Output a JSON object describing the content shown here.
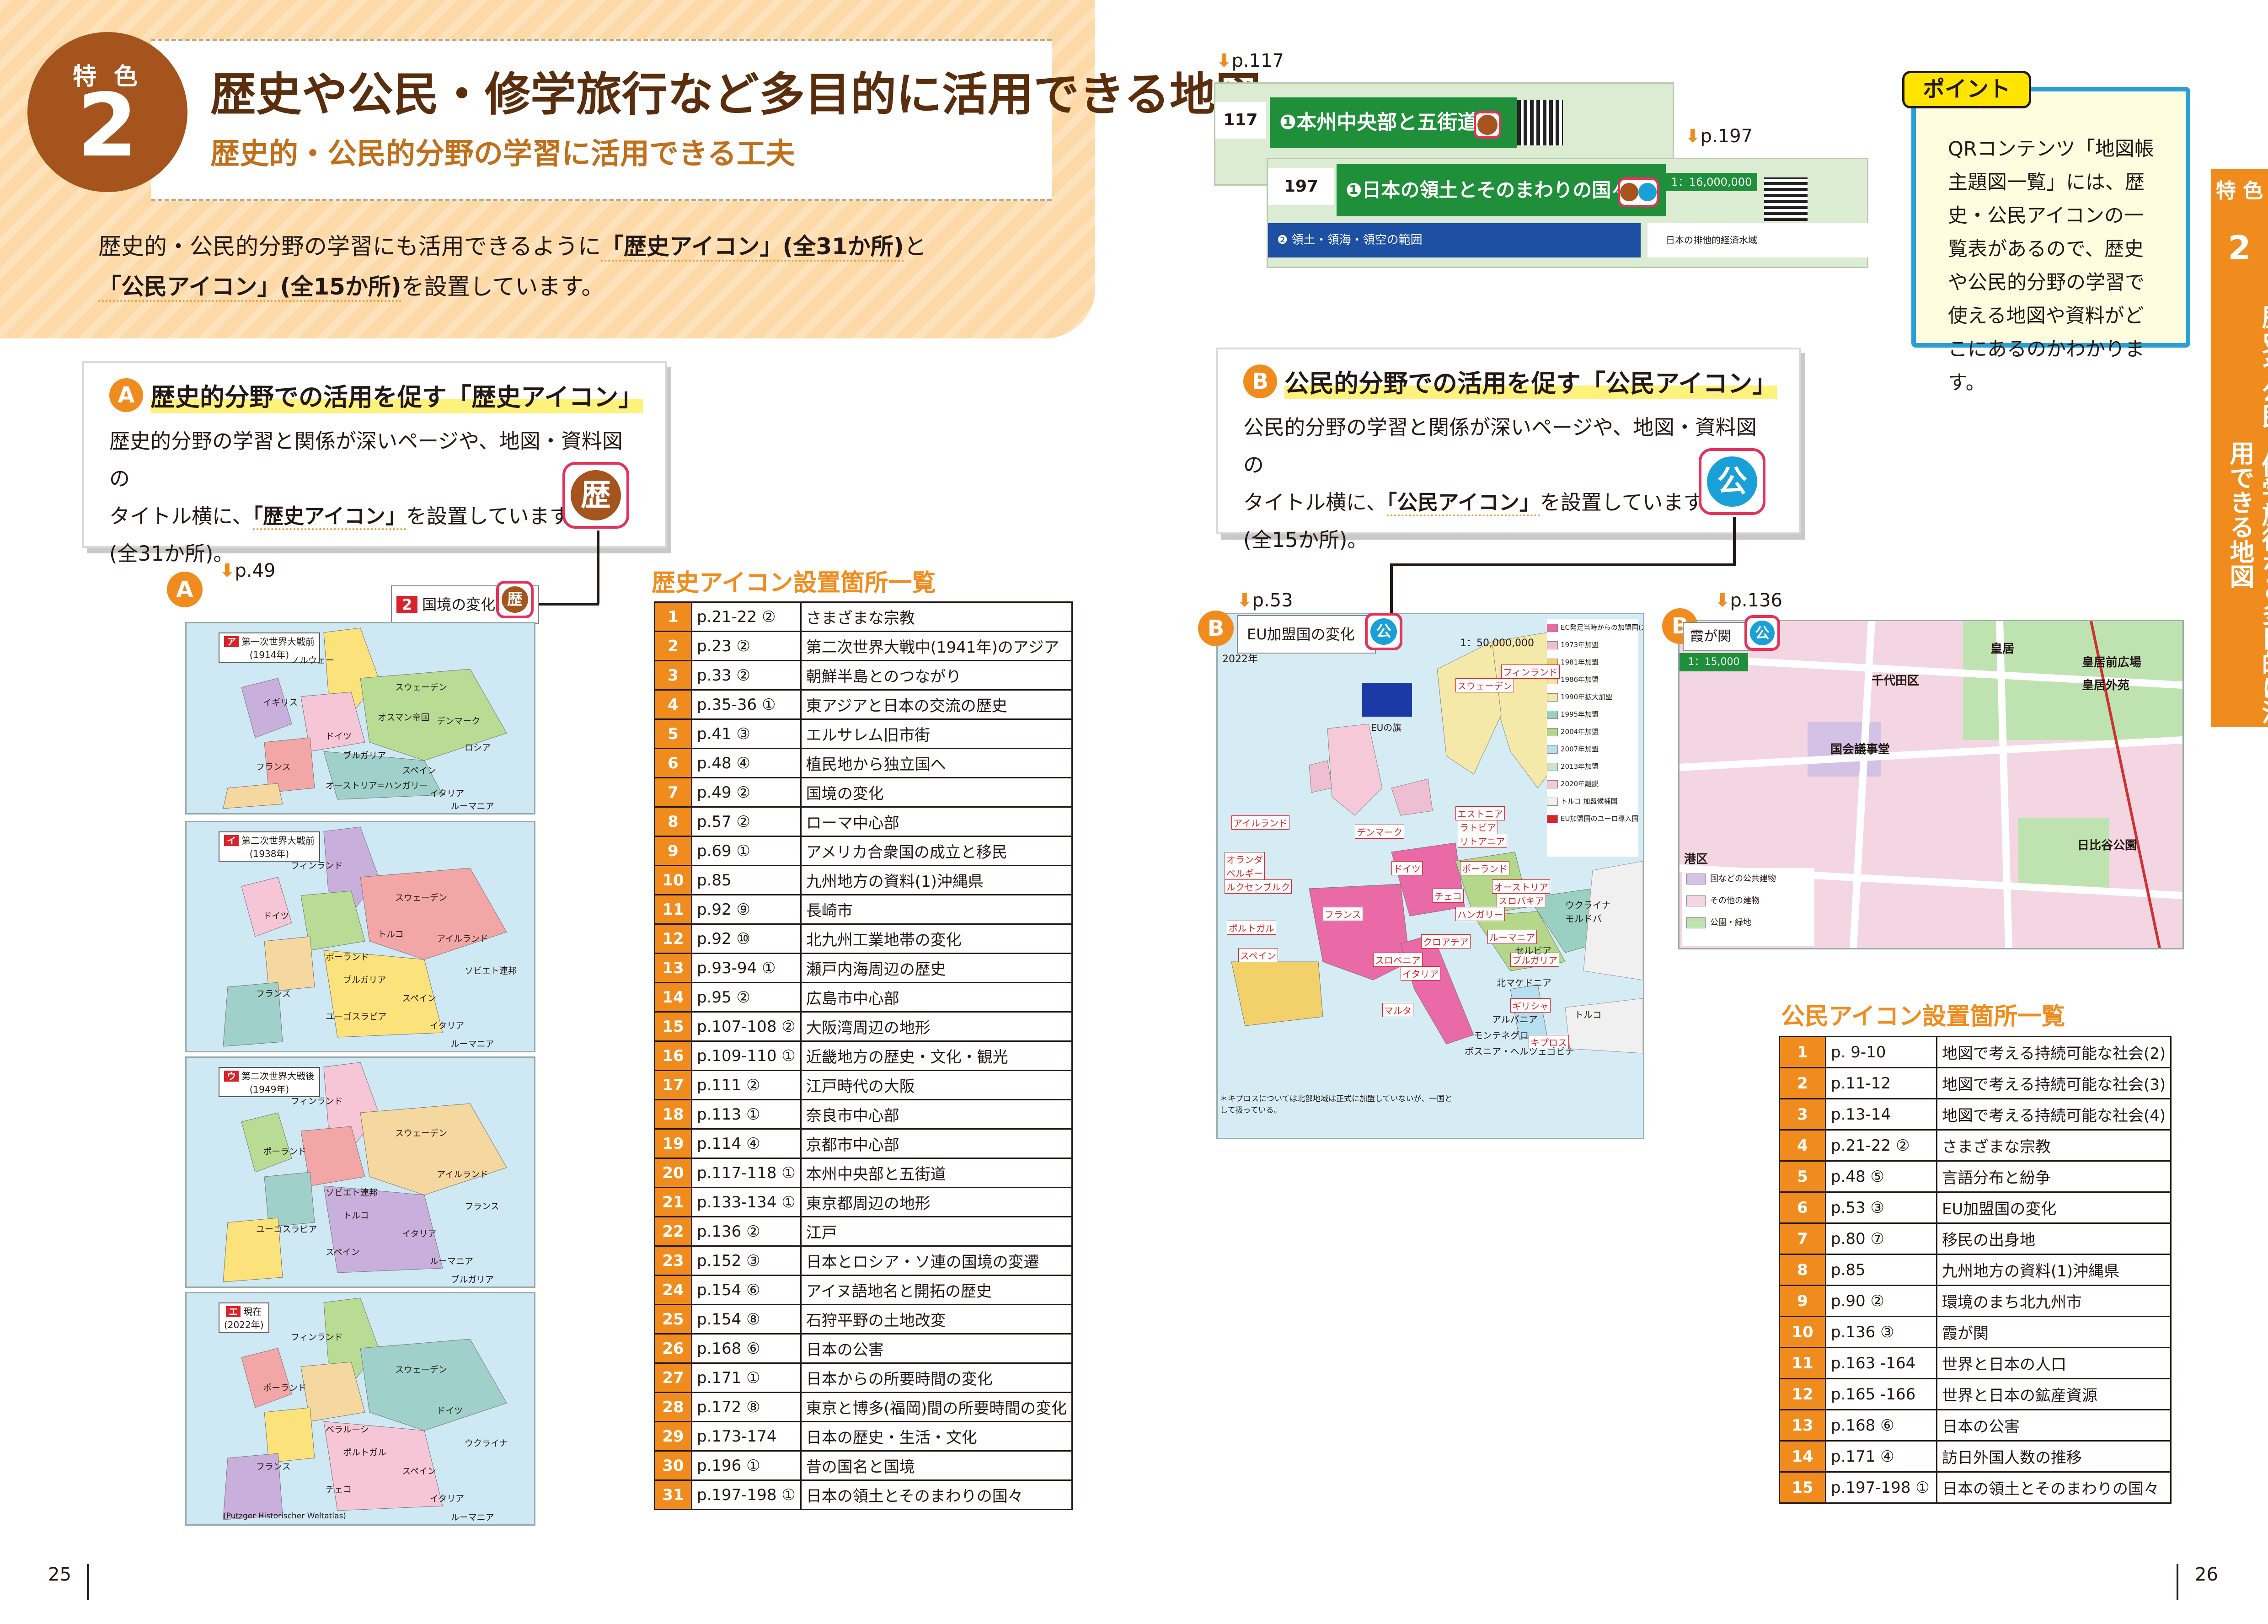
{
  "header": {
    "badge_label": "特 色",
    "badge_number": "2",
    "title": "歴史や公民・修学旅行など多目的に活用できる地図",
    "subtitle": "歴史的・公民的分野の学習に活用できる工夫",
    "intro_a": "歴史的・公民的分野の学習にも活用できるように",
    "intro_b1": "「歴史アイコン」(全31か所)",
    "intro_c": "と",
    "intro_b2": "「公民アイコン」(全15か所)",
    "intro_d": "を設置しています。"
  },
  "side_tab": {
    "label": "特 色",
    "number": "2",
    "text": "歴史や公民・修学旅行など多目的に活用できる地図"
  },
  "section_a": {
    "marker": "A",
    "heading": "歴史的分野での活用を促す「歴史アイコン」",
    "body_1": "歴史的分野の学習と関係が深いページや、地図・資料図の",
    "body_2a": "タイトル横に、",
    "body_2b": "「歴史アイコン」",
    "body_2c": "を設置しています",
    "body_3": "(全31か所)。",
    "icon_glyph": "歴"
  },
  "section_b": {
    "marker": "B",
    "heading": "公民的分野での活用を促す「公民アイコン」",
    "body_1": "公民的分野の学習と関係が深いページや、地図・資料図の",
    "body_2a": "タイトル横に、",
    "body_2b": "「公民アイコン」",
    "body_2c": "を設置しています",
    "body_3": "(全15か所)。",
    "icon_glyph": "公"
  },
  "point": {
    "tag": "ポイント",
    "text": "QRコンテンツ「地図帳主題図一覧」には、歴史・公民アイコンの一覧表があるので、歴史や公民的分野の学習で使える地図や資料がどこにあるのかわかります。"
  },
  "refs": {
    "p117": "p.117",
    "p197": "p.197",
    "p49": "p.49",
    "p53": "p.53",
    "p136": "p.136",
    "arrow": "⬇"
  },
  "strips": {
    "s117_num": "117",
    "s117_title": "❶本州中央部と五街道",
    "s197_num": "197",
    "s197_title": "❶日本の領土とそのまわりの国々",
    "s197_scale": "1：16,000,000",
    "s197_sub": "❷ 領土・領海・領空の範囲",
    "s197_legend": "日本の排他的経済水域"
  },
  "map_a": {
    "marker": "A",
    "title_label": "国境の変化",
    "title_num": "2",
    "icon_glyph": "歴",
    "panels": [
      {
        "key": "ア",
        "title": "第一次世界大戦前",
        "year": "(1914年)",
        "labels": [
          "ノルウェー",
          "スウェーデン",
          "デンマーク",
          "イギリス",
          "ドイツ",
          "ロシア",
          "フランス",
          "オーストリア=ハンガリー",
          "スペイン",
          "イタリア",
          "ルーマニア",
          "ブルガリア",
          "オスマン帝国"
        ]
      },
      {
        "key": "イ",
        "title": "第二次世界大戦前",
        "year": "(1938年)",
        "labels": [
          "フィンランド",
          "スウェーデン",
          "アイルランド",
          "ドイツ",
          "ポーランド",
          "ソビエト連邦",
          "フランス",
          "ユーゴスラビア",
          "スペイン",
          "イタリア",
          "ルーマニア",
          "ブルガリア",
          "トルコ"
        ]
      },
      {
        "key": "ウ",
        "title": "第二次世界大戦後",
        "year": "(1949年)",
        "labels": [
          "フィンランド",
          "スウェーデン",
          "アイルランド",
          "ポーランド",
          "ソビエト連邦",
          "フランス",
          "ユーゴスラビア",
          "スペイン",
          "イタリア",
          "ルーマニア",
          "ブルガリア",
          "トルコ"
        ]
      },
      {
        "key": "エ",
        "title": "現在",
        "year": "(2022年)",
        "labels": [
          "フィンランド",
          "スウェーデン",
          "ドイツ",
          "ポーランド",
          "ベラルーシ",
          "ウクライナ",
          "フランス",
          "チェコ",
          "スペイン",
          "イタリア",
          "ルーマニア",
          "ポルトガル"
        ]
      }
    ],
    "credit": "(Putzger Historischer Weltatlas)"
  },
  "map_b1": {
    "marker": "B",
    "title": "EU加盟国の変化",
    "icon_glyph": "公",
    "year": "2022年",
    "scale": "1：50,000,000",
    "flag_caption": "EUの旗",
    "legend": [
      "EC発足当時からの加盟国(1967年)",
      "1973年加盟",
      "1981年加盟",
      "1986年加盟",
      "1990年拡大加盟",
      "1995年加盟",
      "2004年加盟",
      "2007年加盟",
      "2013年加盟",
      "2020年離脱",
      "トルコ 加盟候補国",
      "EU加盟国のユーロ導入国"
    ],
    "countries": [
      "アイルランド",
      "デンマーク",
      "スウェーデン",
      "フィンランド",
      "エストニア",
      "ラトビア",
      "リトアニア",
      "オランダ",
      "ベルギー",
      "ルクセンブルク",
      "ドイツ",
      "ポーランド",
      "チェコ",
      "オーストリア",
      "スロバキア",
      "フランス",
      "ハンガリー",
      "ルーマニア",
      "ポルトガル",
      "スペイン",
      "スロベニア",
      "クロアチア",
      "イタリア",
      "ブルガリア",
      "ギリシャ",
      "マルタ",
      "キプロス",
      "ウクライナ",
      "モルドバ",
      "セルビア",
      "北マケドニア",
      "アルバニア",
      "モンテネグロ",
      "ボスニア・ヘルツェゴビナ",
      "トルコ"
    ],
    "note": "＊キプロスについては北部地域は正式に加盟していないが、一国として扱っている。"
  },
  "map_b2": {
    "marker": "B",
    "title": "霞が関",
    "icon_glyph": "公",
    "scale": "1：15,000",
    "labels": [
      "皇居",
      "千代田区",
      "皇居前広場",
      "皇居外苑",
      "国会議事堂",
      "日比谷公園",
      "港区"
    ],
    "legend": [
      "国などの公共建物",
      "その他の建物",
      "公園・緑地"
    ]
  },
  "list_a": {
    "title": "歴史アイコン設置箇所一覧",
    "rows": [
      [
        "1",
        "p.21-22 ②",
        "さまざまな宗教"
      ],
      [
        "2",
        "p.23 ②",
        "第二次世界大戦中(1941年)のアジア"
      ],
      [
        "3",
        "p.33 ②",
        "朝鮮半島とのつながり"
      ],
      [
        "4",
        "p.35-36 ①",
        "東アジアと日本の交流の歴史"
      ],
      [
        "5",
        "p.41 ③",
        "エルサレム旧市街"
      ],
      [
        "6",
        "p.48 ④",
        "植民地から独立国へ"
      ],
      [
        "7",
        "p.49 ②",
        "国境の変化"
      ],
      [
        "8",
        "p.57 ②",
        "ローマ中心部"
      ],
      [
        "9",
        "p.69 ①",
        "アメリカ合衆国の成立と移民"
      ],
      [
        "10",
        "p.85",
        "九州地方の資料(1)沖縄県"
      ],
      [
        "11",
        "p.92 ⑨",
        "長崎市"
      ],
      [
        "12",
        "p.92 ⑩",
        "北九州工業地帯の変化"
      ],
      [
        "13",
        "p.93-94 ①",
        "瀬戸内海周辺の歴史"
      ],
      [
        "14",
        "p.95 ②",
        "広島市中心部"
      ],
      [
        "15",
        "p.107-108 ②",
        "大阪湾周辺の地形"
      ],
      [
        "16",
        "p.109-110 ①",
        "近畿地方の歴史・文化・観光"
      ],
      [
        "17",
        "p.111 ②",
        "江戸時代の大阪"
      ],
      [
        "18",
        "p.113 ①",
        "奈良市中心部"
      ],
      [
        "19",
        "p.114 ④",
        "京都市中心部"
      ],
      [
        "20",
        "p.117-118 ①",
        "本州中央部と五街道"
      ],
      [
        "21",
        "p.133-134 ①",
        "東京都周辺の地形"
      ],
      [
        "22",
        "p.136 ②",
        "江戸"
      ],
      [
        "23",
        "p.152 ③",
        "日本とロシア・ソ連の国境の変遷"
      ],
      [
        "24",
        "p.154 ⑥",
        "アイヌ語地名と開拓の歴史"
      ],
      [
        "25",
        "p.154 ⑧",
        "石狩平野の土地改変"
      ],
      [
        "26",
        "p.168 ⑥",
        "日本の公害"
      ],
      [
        "27",
        "p.171 ①",
        "日本からの所要時間の変化"
      ],
      [
        "28",
        "p.172 ⑧",
        "東京と博多(福岡)間の所要時間の変化"
      ],
      [
        "29",
        "p.173-174",
        "日本の歴史・生活・文化"
      ],
      [
        "30",
        "p.196 ①",
        "昔の国名と国境"
      ],
      [
        "31",
        "p.197-198 ①",
        "日本の領土とそのまわりの国々"
      ]
    ]
  },
  "list_b": {
    "title": "公民アイコン設置箇所一覧",
    "rows": [
      [
        "1",
        "p. 9-10",
        "地図で考える持続可能な社会(2)"
      ],
      [
        "2",
        "p.11-12",
        "地図で考える持続可能な社会(3)"
      ],
      [
        "3",
        "p.13-14",
        "地図で考える持続可能な社会(4)"
      ],
      [
        "4",
        "p.21-22 ②",
        "さまざまな宗教"
      ],
      [
        "5",
        "p.48 ⑤",
        "言語分布と紛争"
      ],
      [
        "6",
        "p.53 ③",
        "EU加盟国の変化"
      ],
      [
        "7",
        "p.80 ⑦",
        "移民の出身地"
      ],
      [
        "8",
        "p.85",
        "九州地方の資料(1)沖縄県"
      ],
      [
        "9",
        "p.90 ②",
        "環境のまち北九州市"
      ],
      [
        "10",
        "p.136 ③",
        "霞が関"
      ],
      [
        "11",
        "p.163 -164",
        "世界と日本の人口"
      ],
      [
        "12",
        "p.165 -166",
        "世界と日本の鉱産資源"
      ],
      [
        "13",
        "p.168 ⑥",
        "日本の公害"
      ],
      [
        "14",
        "p.171 ④",
        "訪日外国人数の推移"
      ],
      [
        "15",
        "p.197-198 ①",
        "日本の領土とそのまわりの国々"
      ]
    ]
  },
  "page_numbers": {
    "left": "25",
    "right": "26"
  },
  "colors": {
    "accent": "#f08c1e",
    "brown": "#a4541c",
    "koumin_blue": "#1aa0d8",
    "frame_red": "#e4325b",
    "point_blue": "#2a9fd6"
  }
}
